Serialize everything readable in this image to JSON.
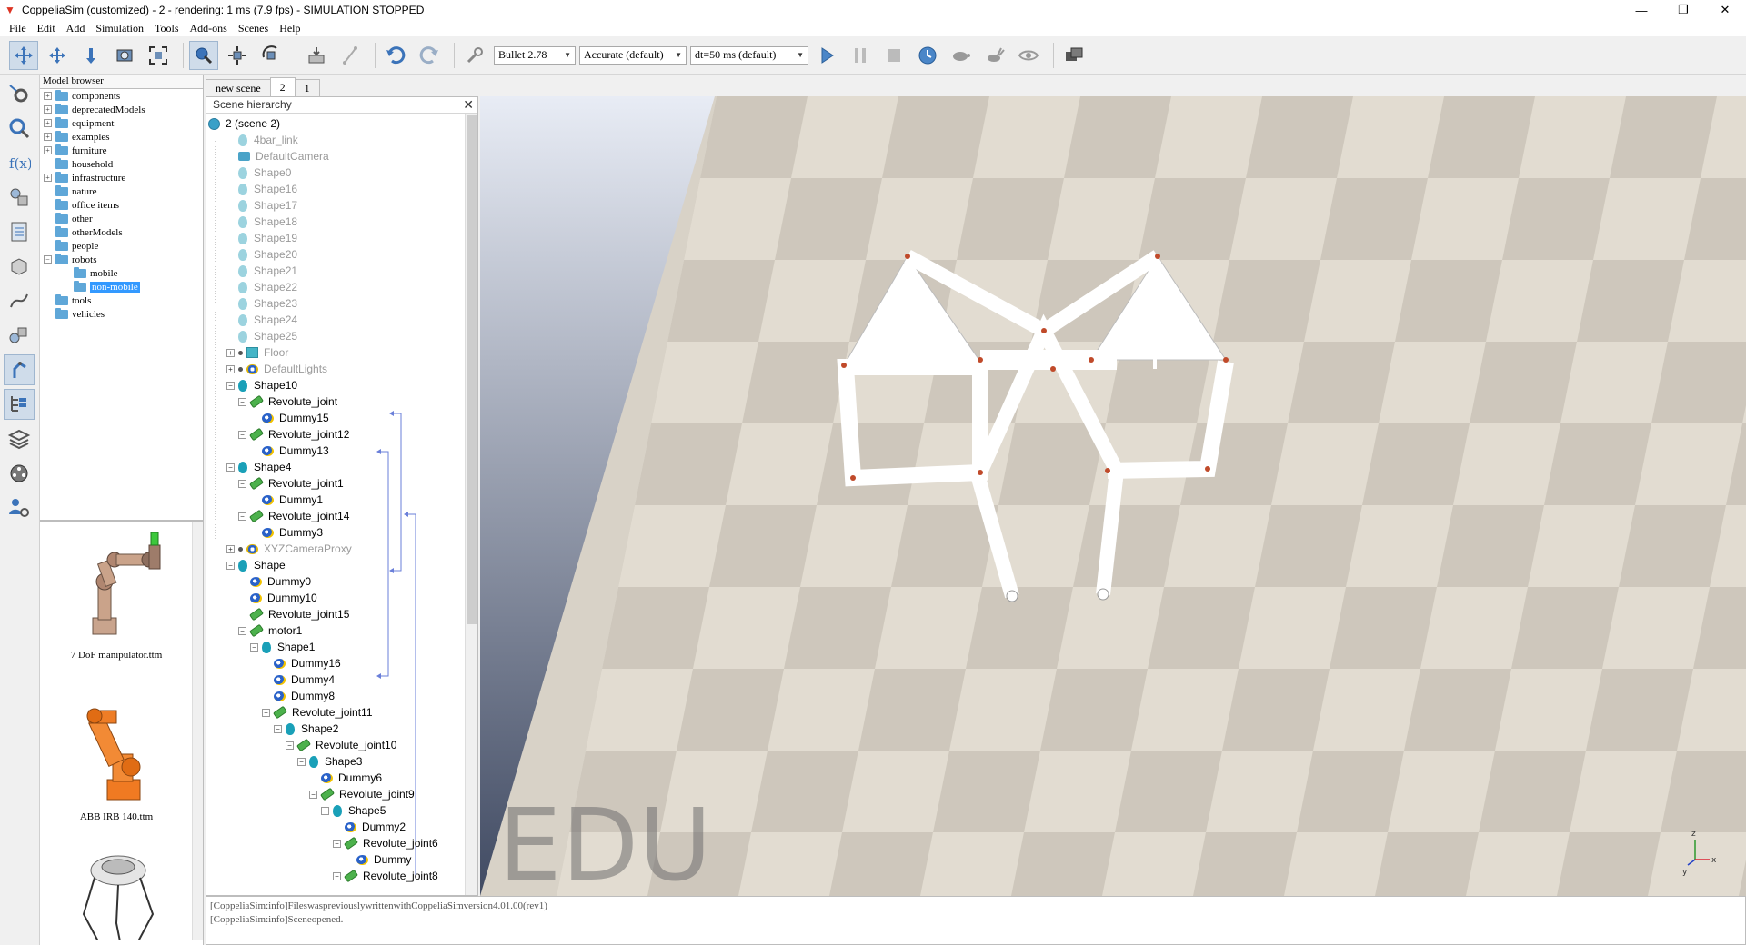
{
  "window": {
    "title": "CoppeliaSim (customized) - 2 - rendering: 1 ms (7.9 fps) - SIMULATION STOPPED",
    "min": "—",
    "max": "❐",
    "close": "✕"
  },
  "menu": [
    "File",
    "Edit",
    "Add",
    "Simulation",
    "Tools",
    "Add-ons",
    "Scenes",
    "Help"
  ],
  "toolbar": {
    "engine": "Bullet 2.78",
    "accuracy": "Accurate (default)",
    "dt": "dt=50 ms (default)"
  },
  "model_browser": {
    "title": "Model browser",
    "items": [
      {
        "label": "components",
        "expander": "+",
        "depth": 0
      },
      {
        "label": "deprecatedModels",
        "expander": "+",
        "depth": 0
      },
      {
        "label": "equipment",
        "expander": "+",
        "depth": 0
      },
      {
        "label": "examples",
        "expander": "+",
        "depth": 0
      },
      {
        "label": "furniture",
        "expander": "+",
        "depth": 0
      },
      {
        "label": "household",
        "expander": "",
        "depth": 0
      },
      {
        "label": "infrastructure",
        "expander": "+",
        "depth": 0
      },
      {
        "label": "nature",
        "expander": "",
        "depth": 0
      },
      {
        "label": "office items",
        "expander": "",
        "depth": 0
      },
      {
        "label": "other",
        "expander": "",
        "depth": 0
      },
      {
        "label": "otherModels",
        "expander": "",
        "depth": 0
      },
      {
        "label": "people",
        "expander": "",
        "depth": 0
      },
      {
        "label": "robots",
        "expander": "−",
        "depth": 0
      },
      {
        "label": "mobile",
        "expander": "",
        "depth": 1
      },
      {
        "label": "non-mobile",
        "expander": "",
        "depth": 1,
        "selected": true
      },
      {
        "label": "tools",
        "expander": "",
        "depth": 0
      },
      {
        "label": "vehicles",
        "expander": "",
        "depth": 0
      }
    ],
    "thumbnails": [
      {
        "label": "7 DoF manipulator.ttm"
      },
      {
        "label": "ABB IRB 140.ttm"
      },
      {
        "label": ""
      }
    ]
  },
  "tabs": [
    {
      "label": "new scene",
      "selected": false
    },
    {
      "label": "2",
      "selected": true
    },
    {
      "label": "1",
      "selected": false
    }
  ],
  "scene_hierarchy": {
    "title": "Scene hierarchy",
    "close": "✕",
    "items": [
      {
        "label": "2 (scene 2)",
        "icon": "scene",
        "depth": 0,
        "dim": false,
        "exp": ""
      },
      {
        "label": "4bar_link",
        "icon": "shape-lt",
        "depth": 1,
        "dim": true,
        "exp": ""
      },
      {
        "label": "DefaultCamera",
        "icon": "camera",
        "depth": 1,
        "dim": true,
        "exp": ""
      },
      {
        "label": "Shape0",
        "icon": "shape-lt",
        "depth": 1,
        "dim": true,
        "exp": ""
      },
      {
        "label": "Shape16",
        "icon": "shape-lt",
        "depth": 1,
        "dim": true,
        "exp": ""
      },
      {
        "label": "Shape17",
        "icon": "shape-lt",
        "depth": 1,
        "dim": true,
        "exp": ""
      },
      {
        "label": "Shape18",
        "icon": "shape-lt",
        "depth": 1,
        "dim": true,
        "exp": ""
      },
      {
        "label": "Shape19",
        "icon": "shape-lt",
        "depth": 1,
        "dim": true,
        "exp": ""
      },
      {
        "label": "Shape20",
        "icon": "shape-lt",
        "depth": 1,
        "dim": true,
        "exp": ""
      },
      {
        "label": "Shape21",
        "icon": "shape-lt",
        "depth": 1,
        "dim": true,
        "exp": ""
      },
      {
        "label": "Shape22",
        "icon": "shape-lt",
        "depth": 1,
        "dim": true,
        "exp": ""
      },
      {
        "label": "Shape23",
        "icon": "shape-lt",
        "depth": 1,
        "dim": true,
        "exp": ""
      },
      {
        "label": "Shape24",
        "icon": "shape-lt",
        "depth": 1,
        "dim": true,
        "exp": ""
      },
      {
        "label": "Shape25",
        "icon": "shape-lt",
        "depth": 1,
        "dim": true,
        "exp": ""
      },
      {
        "label": "Floor",
        "icon": "floor",
        "depth": 1,
        "dim": true,
        "exp": "+",
        "dot": true
      },
      {
        "label": "DefaultLights",
        "icon": "lights",
        "depth": 1,
        "dim": true,
        "exp": "+",
        "dot": true
      },
      {
        "label": "Shape10",
        "icon": "shape",
        "depth": 1,
        "dim": false,
        "exp": "−"
      },
      {
        "label": "Revolute_joint",
        "icon": "joint",
        "depth": 2,
        "dim": false,
        "exp": "−"
      },
      {
        "label": "Dummy15",
        "icon": "dummy",
        "depth": 3,
        "dim": false,
        "exp": ""
      },
      {
        "label": "Revolute_joint12",
        "icon": "joint",
        "depth": 2,
        "dim": false,
        "exp": "−"
      },
      {
        "label": "Dummy13",
        "icon": "dummy",
        "depth": 3,
        "dim": false,
        "exp": ""
      },
      {
        "label": "Shape4",
        "icon": "shape",
        "depth": 1,
        "dim": false,
        "exp": "−"
      },
      {
        "label": "Revolute_joint1",
        "icon": "joint",
        "depth": 2,
        "dim": false,
        "exp": "−"
      },
      {
        "label": "Dummy1",
        "icon": "dummy",
        "depth": 3,
        "dim": false,
        "exp": ""
      },
      {
        "label": "Revolute_joint14",
        "icon": "joint",
        "depth": 2,
        "dim": false,
        "exp": "−"
      },
      {
        "label": "Dummy3",
        "icon": "dummy",
        "depth": 3,
        "dim": false,
        "exp": ""
      },
      {
        "label": "XYZCameraProxy",
        "icon": "lights",
        "depth": 1,
        "dim": true,
        "exp": "+",
        "dot": true
      },
      {
        "label": "Shape",
        "icon": "shape",
        "depth": 1,
        "dim": false,
        "exp": "−"
      },
      {
        "label": "Dummy0",
        "icon": "dummy",
        "depth": 2,
        "dim": false,
        "exp": ""
      },
      {
        "label": "Dummy10",
        "icon": "dummy",
        "depth": 2,
        "dim": false,
        "exp": ""
      },
      {
        "label": "Revolute_joint15",
        "icon": "joint",
        "depth": 2,
        "dim": false,
        "exp": ""
      },
      {
        "label": "motor1",
        "icon": "joint",
        "depth": 2,
        "dim": false,
        "exp": "−"
      },
      {
        "label": "Shape1",
        "icon": "shape",
        "depth": 3,
        "dim": false,
        "exp": "−"
      },
      {
        "label": "Dummy16",
        "icon": "dummy",
        "depth": 4,
        "dim": false,
        "exp": ""
      },
      {
        "label": "Dummy4",
        "icon": "dummy",
        "depth": 4,
        "dim": false,
        "exp": ""
      },
      {
        "label": "Dummy8",
        "icon": "dummy",
        "depth": 4,
        "dim": false,
        "exp": ""
      },
      {
        "label": "Revolute_joint11",
        "icon": "joint",
        "depth": 4,
        "dim": false,
        "exp": "−"
      },
      {
        "label": "Shape2",
        "icon": "shape",
        "depth": 5,
        "dim": false,
        "exp": "−"
      },
      {
        "label": "Revolute_joint10",
        "icon": "joint",
        "depth": 6,
        "dim": false,
        "exp": "−"
      },
      {
        "label": "Shape3",
        "icon": "shape",
        "depth": 7,
        "dim": false,
        "exp": "−"
      },
      {
        "label": "Dummy6",
        "icon": "dummy",
        "depth": 8,
        "dim": false,
        "exp": ""
      },
      {
        "label": "Revolute_joint9",
        "icon": "joint",
        "depth": 8,
        "dim": false,
        "exp": "−"
      },
      {
        "label": "Shape5",
        "icon": "shape",
        "depth": 9,
        "dim": false,
        "exp": "−"
      },
      {
        "label": "Dummy2",
        "icon": "dummy",
        "depth": 10,
        "dim": false,
        "exp": ""
      },
      {
        "label": "Revolute_joint6",
        "icon": "joint",
        "depth": 10,
        "dim": false,
        "exp": "−"
      },
      {
        "label": "Dummy",
        "icon": "dummy",
        "depth": 11,
        "dim": false,
        "exp": ""
      },
      {
        "label": "Revolute_joint8",
        "icon": "joint",
        "depth": 10,
        "dim": false,
        "exp": "−"
      }
    ]
  },
  "viewport": {
    "watermark": "EDU",
    "axis_x": "x",
    "axis_y": "y",
    "axis_z": "z"
  },
  "console": {
    "lines": [
      "[CoppeliaSim:info]FileswaspreviouslywrittenwithCoppeliaSimversion4.01.00(rev1)",
      "[CoppeliaSim:info]Sceneopened."
    ]
  }
}
